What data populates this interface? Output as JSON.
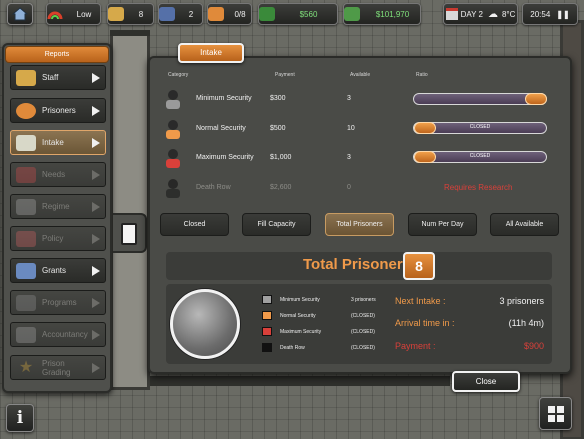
{
  "topbar": {
    "security_level": "Low",
    "staff_count": "8",
    "guard_count": "2",
    "prisoner_count": "0/8",
    "cashflow": "$560",
    "balance": "$101,970",
    "day": "DAY 2",
    "temperature": "8°C",
    "time": "20:54",
    "icons": {
      "home": "home-icon",
      "danger": "danger-gauge-icon",
      "staff": "staff-icon",
      "guards": "guard-icon",
      "prisoners": "prisoner-icon",
      "cashflow": "cashflow-icon",
      "balance": "money-icon",
      "calendar": "calendar-icon",
      "weather": "cloud-icon",
      "pause": "pause-icon"
    }
  },
  "sidebar": {
    "title": "Reports",
    "items": [
      {
        "label": "Staff",
        "icon": "staff-icon",
        "enabled": true
      },
      {
        "label": "Prisoners",
        "icon": "prisoner-icon",
        "enabled": true
      },
      {
        "label": "Intake",
        "icon": "intake-money-icon",
        "enabled": true,
        "active": true
      },
      {
        "label": "Needs",
        "icon": "needs-icon",
        "enabled": false
      },
      {
        "label": "Regime",
        "icon": "regime-icon",
        "enabled": false
      },
      {
        "label": "Policy",
        "icon": "policy-icon",
        "enabled": false
      },
      {
        "label": "Grants",
        "icon": "grants-icon",
        "enabled": true
      },
      {
        "label": "Programs",
        "icon": "programs-icon",
        "enabled": false
      },
      {
        "label": "Accountancy",
        "icon": "accountancy-icon",
        "enabled": false
      },
      {
        "label": "Prison Grading",
        "icon": "star-icon",
        "enabled": false
      }
    ]
  },
  "panel": {
    "tab_label": "Intake",
    "columns": {
      "category": "Category",
      "payment": "Payment",
      "available": "Available",
      "ratio": "Ratio"
    },
    "rows": [
      {
        "name": "Minimum Security",
        "payment": "$300",
        "available": "3",
        "ratio": 0.92,
        "status": "",
        "color": "#b0b0b0"
      },
      {
        "name": "Normal Security",
        "payment": "$500",
        "available": "10",
        "ratio": 0.0,
        "status": "CLOSED",
        "color": "#f09a4a"
      },
      {
        "name": "Maximum Security",
        "payment": "$1,000",
        "available": "3",
        "ratio": 0.0,
        "status": "CLOSED",
        "color": "#d9403a"
      },
      {
        "name": "Death Row",
        "payment": "$2,600",
        "available": "0",
        "status": "Requires Research",
        "color": "#2a2a2a"
      }
    ],
    "modes": [
      "Closed",
      "Fill Capacity",
      "Total Prisoners",
      "Num Per Day",
      "All Available"
    ],
    "active_mode": "Total Prisoners",
    "total_label": "Total Prisoners",
    "total_value": "8",
    "legend": [
      {
        "name": "Minimum Security",
        "value": "3 prisoners",
        "color": "#a0a0a0"
      },
      {
        "name": "Normal Security",
        "value": "(CLOSED)",
        "color": "#f09a4a"
      },
      {
        "name": "Maximum Security",
        "value": "(CLOSED)",
        "color": "#d9403a"
      },
      {
        "name": "Death Row",
        "value": "(CLOSED)",
        "color": "#111111"
      }
    ],
    "next_intake_label": "Next Intake :",
    "next_intake_value": "3 prisoners",
    "arrival_label": "Arrival time in :",
    "arrival_value": "(11h 4m)",
    "payment_label": "Payment :",
    "payment_value": "$900",
    "close_label": "Close"
  },
  "bottom": {
    "info_icon": "info-icon",
    "grid_icon": "grid-menu-icon"
  }
}
